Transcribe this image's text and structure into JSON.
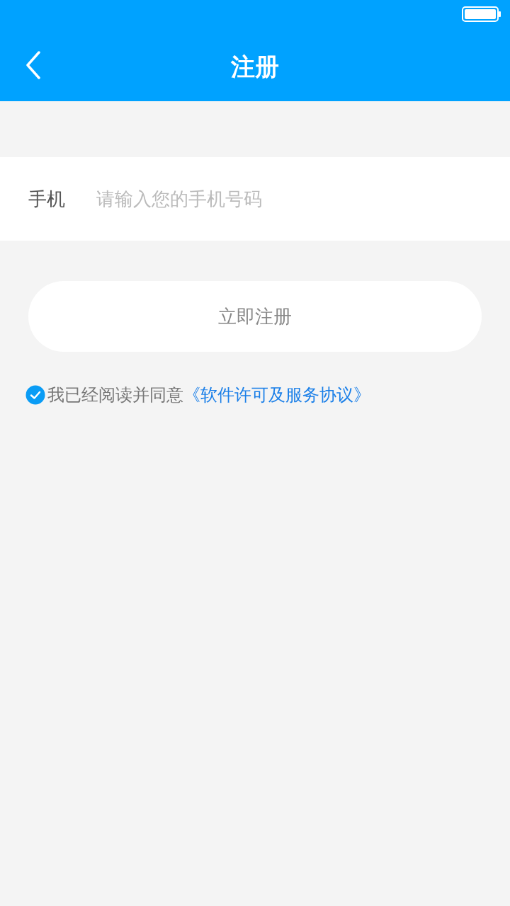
{
  "nav": {
    "title": "注册"
  },
  "phone_field": {
    "label": "手机",
    "placeholder": "请输入您的手机号码"
  },
  "register_button": {
    "label": "立即注册"
  },
  "agreement": {
    "checked": true,
    "text": "我已经阅读并同意",
    "link": "《软件许可及服务协议》"
  }
}
